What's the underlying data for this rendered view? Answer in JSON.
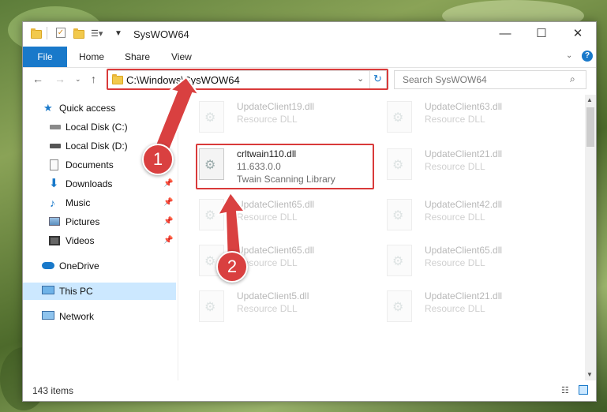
{
  "window": {
    "title": "SysWOW64"
  },
  "ribbon": {
    "file": "File",
    "home": "Home",
    "share": "Share",
    "view": "View"
  },
  "address": {
    "path": "C:\\Windows\\SysWOW64"
  },
  "search": {
    "placeholder": "Search SysWOW64"
  },
  "sidebar": {
    "items": [
      {
        "label": "Quick access"
      },
      {
        "label": "Local Disk (C:)"
      },
      {
        "label": "Local Disk (D:)"
      },
      {
        "label": "Documents"
      },
      {
        "label": "Downloads"
      },
      {
        "label": "Music"
      },
      {
        "label": "Pictures"
      },
      {
        "label": "Videos"
      },
      {
        "label": "OneDrive"
      },
      {
        "label": "This PC"
      },
      {
        "label": "Network"
      }
    ]
  },
  "files": {
    "left": [
      {
        "name": "UpdateClient19.dll",
        "desc": "Resource DLL"
      },
      {
        "name": "crltwain110.dll",
        "version": "11.633.0.0",
        "desc": "Twain Scanning Library"
      },
      {
        "name": "UpdateClient65.dll",
        "desc": "Resource DLL"
      },
      {
        "name": "UpdateClient65.dll",
        "desc": "Resource DLL"
      },
      {
        "name": "UpdateClient5.dll",
        "desc": "Resource DLL"
      }
    ],
    "right": [
      {
        "name": "UpdateClient63.dll",
        "desc": "Resource DLL"
      },
      {
        "name": "UpdateClient21.dll",
        "desc": "Resource DLL"
      },
      {
        "name": "UpdateClient42.dll",
        "desc": "Resource DLL"
      },
      {
        "name": "UpdateClient65.dll",
        "desc": "Resource DLL"
      },
      {
        "name": "UpdateClient21.dll",
        "desc": "Resource DLL"
      }
    ]
  },
  "status": {
    "count": "143 items"
  },
  "annotations": {
    "step1": "1",
    "step2": "2"
  },
  "colors": {
    "accent": "#1979ca",
    "highlight": "#d93a3a",
    "selected": "#cce8ff"
  }
}
